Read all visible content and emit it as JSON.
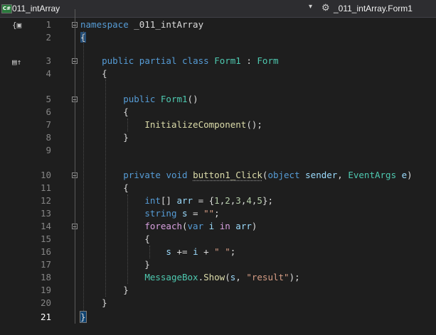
{
  "navbar": {
    "project_icon": "C#",
    "project_name": "011_intArray",
    "dropdown_icon": "chevron-down-icon",
    "class_icon": "class-member-icon",
    "class_name": "_011_intArray.Form1"
  },
  "gutter": {
    "indicators": [
      "references-codelens-icon",
      "inheritance-glyph-icon"
    ]
  },
  "editor": {
    "current_line": 21,
    "lines": [
      {
        "n": "1",
        "tokens": [
          {
            "t": "namespace",
            "c": "kw"
          },
          {
            "t": " _011_intArray",
            "c": "pu"
          }
        ]
      },
      {
        "n": "2",
        "tokens": [
          {
            "t": "{",
            "c": "pu brace-hl"
          }
        ]
      },
      {
        "n": "3",
        "tokens": [
          {
            "t": "    ",
            "c": "pu"
          },
          {
            "t": "public",
            "c": "kw"
          },
          {
            "t": " ",
            "c": "pu"
          },
          {
            "t": "partial",
            "c": "kw"
          },
          {
            "t": " ",
            "c": "pu"
          },
          {
            "t": "class",
            "c": "kw"
          },
          {
            "t": " ",
            "c": "pu"
          },
          {
            "t": "Form1",
            "c": "ty"
          },
          {
            "t": " : ",
            "c": "pu"
          },
          {
            "t": "Form",
            "c": "ty"
          }
        ]
      },
      {
        "n": "4",
        "tokens": [
          {
            "t": "    {",
            "c": "pu"
          }
        ]
      },
      {
        "n": "5",
        "tokens": [
          {
            "t": "        ",
            "c": "pu"
          },
          {
            "t": "public",
            "c": "kw"
          },
          {
            "t": " ",
            "c": "pu"
          },
          {
            "t": "Form1",
            "c": "ty"
          },
          {
            "t": "()",
            "c": "pu"
          }
        ]
      },
      {
        "n": "6",
        "tokens": [
          {
            "t": "        {",
            "c": "pu"
          }
        ]
      },
      {
        "n": "7",
        "tokens": [
          {
            "t": "            ",
            "c": "pu"
          },
          {
            "t": "InitializeComponent",
            "c": "mt"
          },
          {
            "t": "();",
            "c": "pu"
          }
        ]
      },
      {
        "n": "8",
        "tokens": [
          {
            "t": "        }",
            "c": "pu"
          }
        ]
      },
      {
        "n": "9",
        "tokens": []
      },
      {
        "n": "10",
        "tokens": [
          {
            "t": "        ",
            "c": "pu"
          },
          {
            "t": "private",
            "c": "kw"
          },
          {
            "t": " ",
            "c": "pu"
          },
          {
            "t": "void",
            "c": "kw"
          },
          {
            "t": " ",
            "c": "pu"
          },
          {
            "t": "button1_Click",
            "c": "mt sq"
          },
          {
            "t": "(",
            "c": "pu"
          },
          {
            "t": "object",
            "c": "kw"
          },
          {
            "t": " ",
            "c": "pu"
          },
          {
            "t": "sender",
            "c": "id"
          },
          {
            "t": ", ",
            "c": "pu"
          },
          {
            "t": "EventArgs",
            "c": "ty"
          },
          {
            "t": " ",
            "c": "pu"
          },
          {
            "t": "e",
            "c": "id"
          },
          {
            "t": ")",
            "c": "pu"
          }
        ]
      },
      {
        "n": "11",
        "tokens": [
          {
            "t": "        {",
            "c": "pu"
          }
        ]
      },
      {
        "n": "12",
        "tokens": [
          {
            "t": "            ",
            "c": "pu"
          },
          {
            "t": "int",
            "c": "kw"
          },
          {
            "t": "[] ",
            "c": "pu"
          },
          {
            "t": "arr",
            "c": "id"
          },
          {
            "t": " = {",
            "c": "pu"
          },
          {
            "t": "1",
            "c": "nu"
          },
          {
            "t": ",",
            "c": "pu"
          },
          {
            "t": "2",
            "c": "nu"
          },
          {
            "t": ",",
            "c": "pu"
          },
          {
            "t": "3",
            "c": "nu"
          },
          {
            "t": ",",
            "c": "pu"
          },
          {
            "t": "4",
            "c": "nu"
          },
          {
            "t": ",",
            "c": "pu"
          },
          {
            "t": "5",
            "c": "nu"
          },
          {
            "t": "};",
            "c": "pu"
          }
        ]
      },
      {
        "n": "13",
        "tokens": [
          {
            "t": "            ",
            "c": "pu"
          },
          {
            "t": "string",
            "c": "kw"
          },
          {
            "t": " ",
            "c": "pu"
          },
          {
            "t": "s",
            "c": "id"
          },
          {
            "t": " = ",
            "c": "pu"
          },
          {
            "t": "\"\"",
            "c": "st"
          },
          {
            "t": ";",
            "c": "pu"
          }
        ]
      },
      {
        "n": "14",
        "tokens": [
          {
            "t": "            ",
            "c": "pu"
          },
          {
            "t": "foreach",
            "c": "ctl"
          },
          {
            "t": "(",
            "c": "pu"
          },
          {
            "t": "var",
            "c": "kw"
          },
          {
            "t": " ",
            "c": "pu"
          },
          {
            "t": "i",
            "c": "id"
          },
          {
            "t": " ",
            "c": "pu"
          },
          {
            "t": "in",
            "c": "ctl"
          },
          {
            "t": " ",
            "c": "pu"
          },
          {
            "t": "arr",
            "c": "id"
          },
          {
            "t": ")",
            "c": "pu"
          }
        ]
      },
      {
        "n": "15",
        "tokens": [
          {
            "t": "            {",
            "c": "pu"
          }
        ]
      },
      {
        "n": "16",
        "tokens": [
          {
            "t": "                ",
            "c": "pu"
          },
          {
            "t": "s",
            "c": "id"
          },
          {
            "t": " += ",
            "c": "pu"
          },
          {
            "t": "i",
            "c": "id"
          },
          {
            "t": " + ",
            "c": "pu"
          },
          {
            "t": "\" \"",
            "c": "st"
          },
          {
            "t": ";",
            "c": "pu"
          }
        ]
      },
      {
        "n": "17",
        "tokens": [
          {
            "t": "            }",
            "c": "pu"
          }
        ]
      },
      {
        "n": "18",
        "tokens": [
          {
            "t": "            ",
            "c": "pu"
          },
          {
            "t": "MessageBox",
            "c": "ty"
          },
          {
            "t": ".",
            "c": "pu"
          },
          {
            "t": "Show",
            "c": "mt"
          },
          {
            "t": "(",
            "c": "pu"
          },
          {
            "t": "s",
            "c": "id"
          },
          {
            "t": ", ",
            "c": "pu"
          },
          {
            "t": "\"result\"",
            "c": "st"
          },
          {
            "t": ");",
            "c": "pu"
          }
        ]
      },
      {
        "n": "19",
        "tokens": [
          {
            "t": "        }",
            "c": "pu"
          }
        ]
      },
      {
        "n": "20",
        "tokens": [
          {
            "t": "    }",
            "c": "pu"
          }
        ]
      },
      {
        "n": "21",
        "tokens": [
          {
            "t": "}",
            "c": "pu caret-brace"
          }
        ]
      }
    ]
  }
}
